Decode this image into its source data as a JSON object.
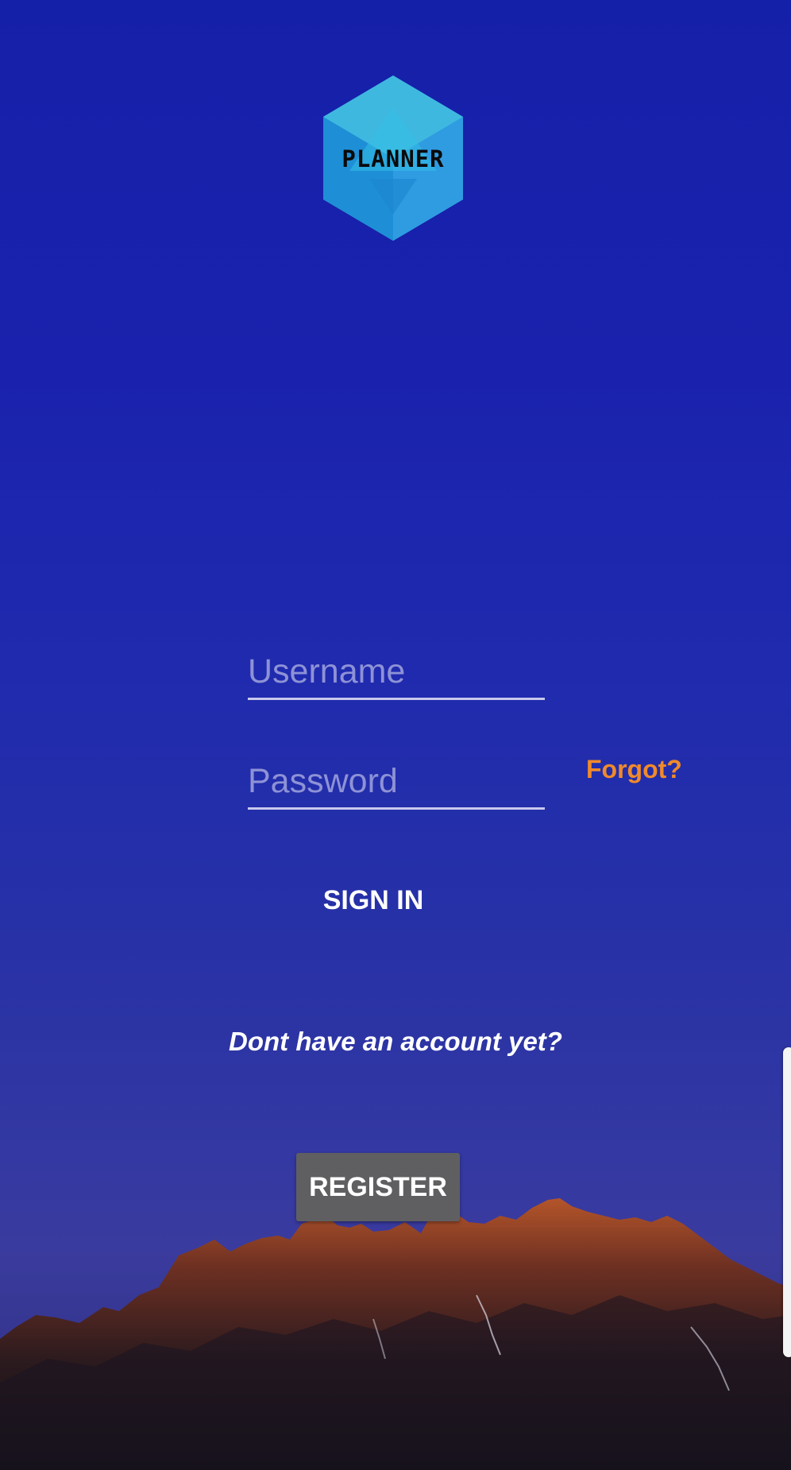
{
  "app": {
    "logo_text": "PLANNER"
  },
  "login": {
    "username_placeholder": "Username",
    "username_value": "",
    "password_placeholder": "Password",
    "password_value": "",
    "forgot_label": "Forgot?",
    "signin_label": "SIGN IN",
    "no_account_text": "Dont have an account yet?",
    "register_label": "REGISTER"
  },
  "colors": {
    "background_top": "#1520a8",
    "background_bottom": "#3a3b9e",
    "accent_orange": "#f08a2a",
    "register_button": "#5f5f62",
    "logo_cyan": "#2ab3e0"
  },
  "icons": {
    "logo": "hexagon-logo-icon",
    "scroll": "scroll-handle"
  }
}
